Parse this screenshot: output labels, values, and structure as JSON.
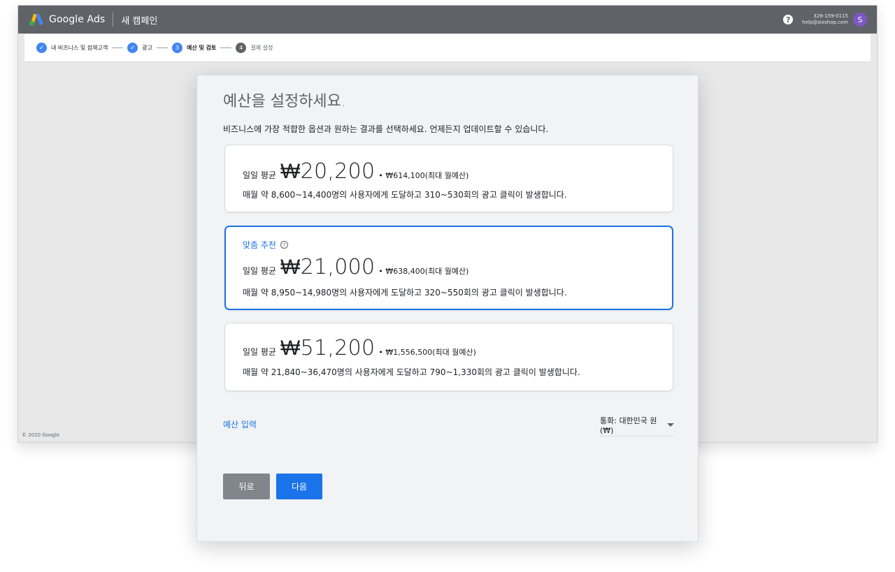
{
  "app": {
    "brand": "Google Ads",
    "title": "새 캠페인",
    "phone": "326-159-0115",
    "email": "help@sixshop.com",
    "avatar_letter": "S",
    "copyright": "© 2020 Google"
  },
  "steps": [
    {
      "label": "내 비즈니스 및 잠재고객",
      "state": "done"
    },
    {
      "label": "광고",
      "state": "done"
    },
    {
      "number": "3",
      "label": "예산 및 검토",
      "state": "active"
    },
    {
      "number": "4",
      "label": "결제 설정",
      "state": "idle"
    }
  ],
  "modal": {
    "heading": "예산을 설정하세요.",
    "subtitle": "비즈니스에 가장 적합한 옵션과 원하는 결과를 선택하세요. 언제든지 업데이트할 수 있습니다.",
    "options": [
      {
        "label": "일일 평균",
        "amount": "₩20,200",
        "monthly": "• ₩614,100(최대 월예산)",
        "description": "매월 약 8,600~14,400명의 사용자에게 도달하고 310~530회의 광고 클릭이 발생합니다."
      },
      {
        "recommended": "맞춤 추천",
        "label": "일일 평균",
        "amount": "₩21,000",
        "monthly": "• ₩638,400(최대 월예산)",
        "description": "매월 약 8,950~14,980명의 사용자에게 도달하고 320~550회의 광고 클릭이 발생합니다."
      },
      {
        "label": "일일 평균",
        "amount": "₩51,200",
        "monthly": "• ₩1,556,500(최대 월예산)",
        "description": "매월 약 21,840~36,470명의 사용자에게 도달하고 790~1,330회의 광고 클릭이 발생합니다."
      }
    ],
    "enter_budget_link": "예산 입력",
    "currency": "통화: 대한민국 원(₩)",
    "back_button": "뒤로",
    "next_button": "다음"
  },
  "colors": {
    "accent": "#1a73e8",
    "topbar": "#5f6368",
    "avatar": "#7e57c2"
  }
}
